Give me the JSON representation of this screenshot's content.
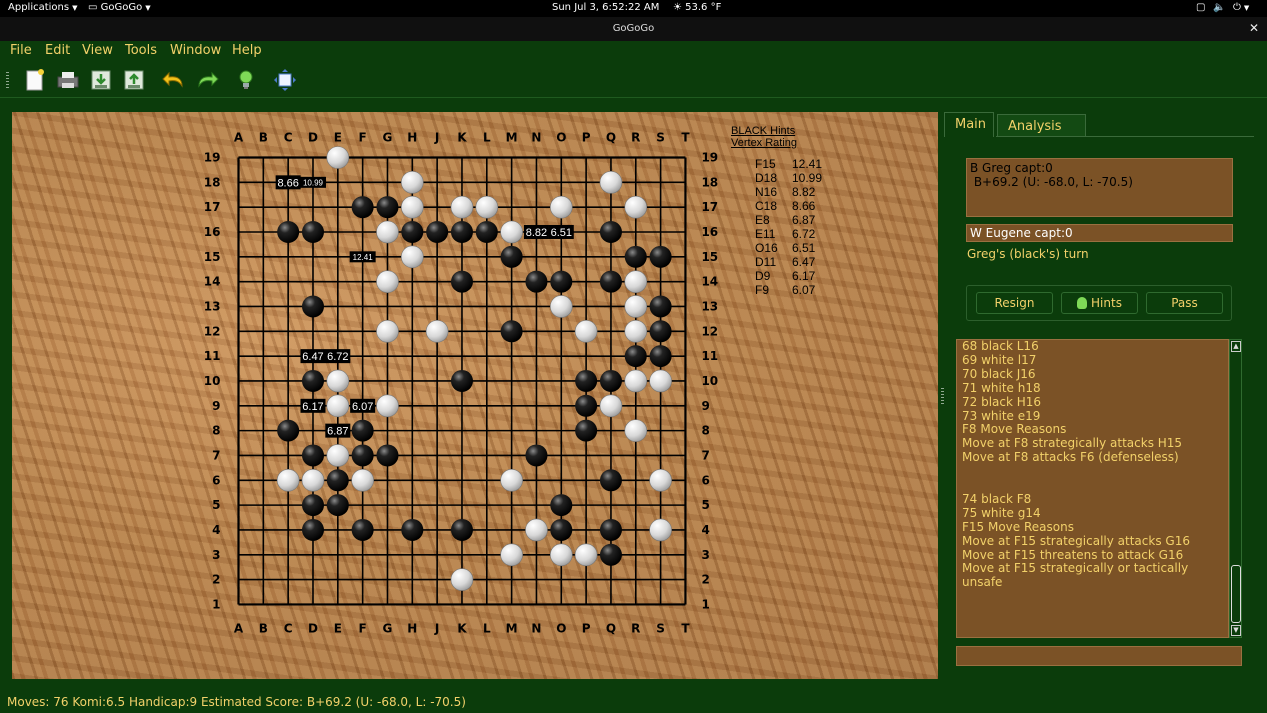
{
  "topbar": {
    "applications": "Applications",
    "app": "GoGoGo",
    "clock": "Sun Jul  3,  6:52:22 AM",
    "weather": "53.6 °F"
  },
  "window": {
    "title": "GoGoGo"
  },
  "menu": [
    "File",
    "Edit",
    "View",
    "Tools",
    "Window",
    "Help"
  ],
  "board": {
    "columns": [
      "A",
      "B",
      "C",
      "D",
      "E",
      "F",
      "G",
      "H",
      "J",
      "K",
      "L",
      "M",
      "N",
      "O",
      "P",
      "Q",
      "R",
      "S",
      "T"
    ],
    "rows": [
      "19",
      "18",
      "17",
      "16",
      "15",
      "14",
      "13",
      "12",
      "11",
      "10",
      "9",
      "8",
      "7",
      "6",
      "5",
      "4",
      "3",
      "2",
      "1"
    ],
    "black": [
      "F17",
      "G17",
      "D16",
      "C16",
      "H16",
      "J16",
      "K16",
      "L16",
      "Q16",
      "S15",
      "R15",
      "M15",
      "K14",
      "N14",
      "O14",
      "Q14",
      "D13",
      "S13",
      "M12",
      "S12",
      "R11",
      "S11",
      "D10",
      "K10",
      "P10",
      "Q10",
      "P9",
      "C8",
      "F8",
      "P8",
      "D7",
      "F7",
      "G7",
      "N7",
      "E6",
      "Q6",
      "D5",
      "E5",
      "O5",
      "D4",
      "F4",
      "H4",
      "K4",
      "O4",
      "Q4",
      "Q3"
    ],
    "white": [
      "E19",
      "H18",
      "Q18",
      "H17",
      "K17",
      "L17",
      "O17",
      "R17",
      "G16",
      "M16",
      "H15",
      "G14",
      "R14",
      "O13",
      "R13",
      "G12",
      "J12",
      "P12",
      "R12",
      "E10",
      "R10",
      "S10",
      "G9",
      "E9",
      "Q9",
      "R8",
      "E7",
      "C6",
      "D6",
      "F6",
      "M6",
      "S6",
      "N4",
      "S4",
      "M3",
      "O3",
      "P3",
      "K2"
    ],
    "labels": [
      {
        "at": "C18",
        "text": "8.66"
      },
      {
        "at": "D18",
        "text": "10.99",
        "small": true
      },
      {
        "at": "N16",
        "text": "8.82"
      },
      {
        "at": "O16",
        "text": "6.51"
      },
      {
        "at": "F15",
        "text": "12.41",
        "small": true
      },
      {
        "at": "D11",
        "text": "6.47"
      },
      {
        "at": "E11",
        "text": "6.72"
      },
      {
        "at": "D9",
        "text": "6.17"
      },
      {
        "at": "F9",
        "text": "6.07"
      },
      {
        "at": "E8",
        "text": "6.87"
      }
    ]
  },
  "hints": {
    "title": "BLACK Hints",
    "header": "Vertex  Rating",
    "rows": [
      {
        "vertex": "F15",
        "rating": "12.41"
      },
      {
        "vertex": "D18",
        "rating": "10.99"
      },
      {
        "vertex": "N16",
        "rating": "8.82"
      },
      {
        "vertex": "C18",
        "rating": "8.66"
      },
      {
        "vertex": "E8",
        "rating": "6.87"
      },
      {
        "vertex": "E11",
        "rating": "6.72"
      },
      {
        "vertex": "O16",
        "rating": "6.51"
      },
      {
        "vertex": "D11",
        "rating": "6.47"
      },
      {
        "vertex": "D9",
        "rating": "6.17"
      },
      {
        "vertex": "F9",
        "rating": "6.07"
      }
    ]
  },
  "tabs": {
    "main": "Main",
    "analysis": "Analysis"
  },
  "players": {
    "black_line": "B Greg capt:0",
    "black_score": " B+69.2 (U: -68.0, L: -70.5)",
    "white_line": "W Eugene capt:0",
    "turn": "Greg's (black's) turn"
  },
  "buttons": {
    "resign": "Resign",
    "hints": "Hints",
    "pass": "Pass"
  },
  "log": [
    "68 black L16",
    "69 white l17",
    "70 black J16",
    "71 white h18",
    "72 black H16",
    "73 white e19",
    "F8 Move Reasons",
    "Move at F8 strategically attacks H15",
    "Move at F8 attacks F6 (defenseless)",
    "",
    "",
    "74 black F8",
    "75 white g14",
    "F15 Move Reasons",
    "Move at F15 strategically attacks G16",
    "Move at F15 threatens to attack G16",
    "Move at F15 strategically or tactically",
    "unsafe"
  ],
  "status": "Moves: 76 Komi:6.5 Handicap:9 Estimated Score: B+69.2 (U: -68.0, L: -70.5)",
  "icons": [
    "new-game-icon",
    "print-icon",
    "save-icon",
    "load-icon",
    "undo-icon",
    "redo-icon",
    "hint-bulb-icon",
    "fullscreen-icon"
  ]
}
